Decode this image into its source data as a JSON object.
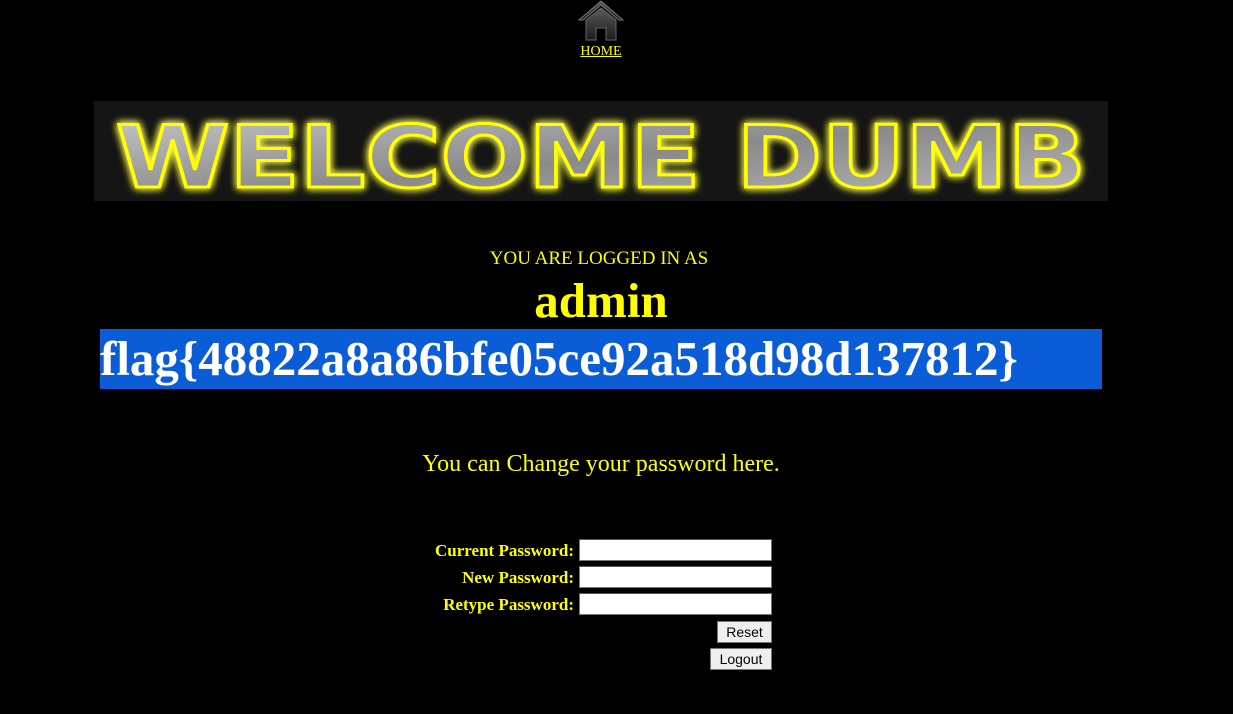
{
  "nav": {
    "home_label": "HOME",
    "home_icon": "home-icon"
  },
  "banner": {
    "text": "WELCOME DUMB"
  },
  "session": {
    "logged_in_label": "YOU ARE LOGGED IN AS",
    "username": "admin",
    "flag": "flag{48822a8a86bfe05ce92a518d98d137812}"
  },
  "form": {
    "intro": "You can Change your password here.",
    "current_password_label": "Current Password:",
    "new_password_label": "New Password:",
    "retype_password_label": "Retype Password:",
    "current_password_value": "",
    "new_password_value": "",
    "retype_password_value": "",
    "reset_label": "Reset",
    "logout_label": "Logout"
  },
  "colors": {
    "background": "#000000",
    "text": "#ffff00",
    "selection": "#0b5dd7",
    "flag_text": "#ffffff"
  }
}
